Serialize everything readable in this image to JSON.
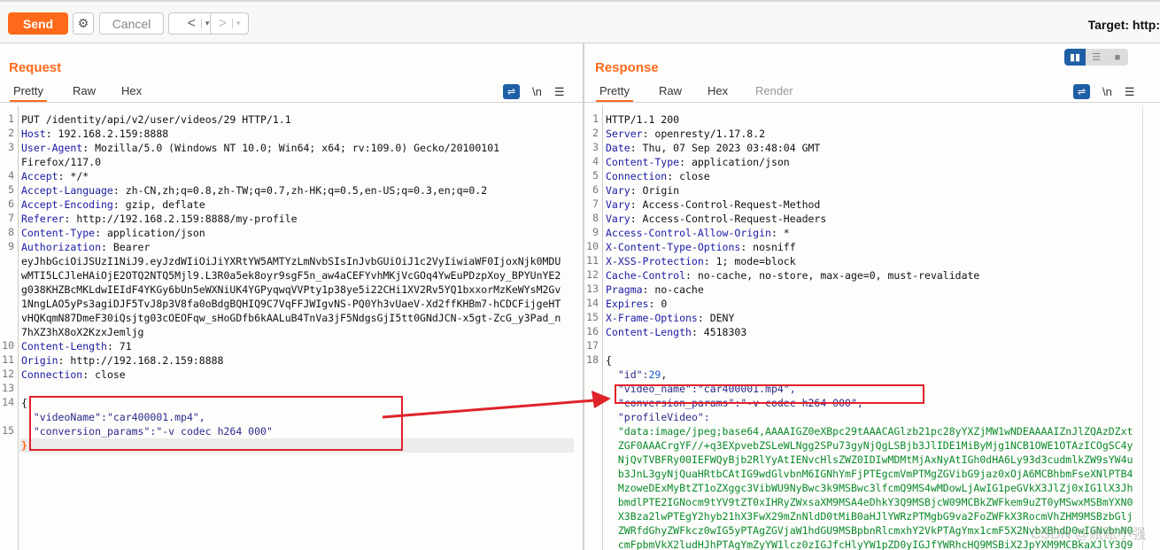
{
  "toolbar": {
    "send": "Send",
    "cancel": "Cancel",
    "back": "<",
    "forward": ">",
    "dropdown": "▾",
    "target": "Target: http:"
  },
  "request": {
    "title": "Request",
    "tabs": [
      "Pretty",
      "Raw",
      "Hex"
    ],
    "newline_label": "\\n",
    "lines": [
      {
        "n": "1",
        "segs": [
          [
            "v",
            "PUT /identity/api/v2/user/videos/29 HTTP/1.1"
          ]
        ]
      },
      {
        "n": "2",
        "segs": [
          [
            "k",
            "Host"
          ],
          [
            "v",
            ": 192.168.2.159:8888"
          ]
        ]
      },
      {
        "n": "3",
        "segs": [
          [
            "k",
            "User-Agent"
          ],
          [
            "v",
            ": Mozilla/5.0 (Windows NT 10.0; Win64; x64; rv:109.0) Gecko/20100101"
          ]
        ]
      },
      {
        "n": "",
        "segs": [
          [
            "v",
            "Firefox/117.0"
          ]
        ]
      },
      {
        "n": "4",
        "segs": [
          [
            "k",
            "Accept"
          ],
          [
            "v",
            ": */*"
          ]
        ]
      },
      {
        "n": "5",
        "segs": [
          [
            "k",
            "Accept-Language"
          ],
          [
            "v",
            ": zh-CN,zh;q=0.8,zh-TW;q=0.7,zh-HK;q=0.5,en-US;q=0.3,en;q=0.2"
          ]
        ]
      },
      {
        "n": "6",
        "segs": [
          [
            "k",
            "Accept-Encoding"
          ],
          [
            "v",
            ": gzip, deflate"
          ]
        ]
      },
      {
        "n": "7",
        "segs": [
          [
            "k",
            "Referer"
          ],
          [
            "v",
            ": http://192.168.2.159:8888/my-profile"
          ]
        ]
      },
      {
        "n": "8",
        "segs": [
          [
            "k",
            "Content-Type"
          ],
          [
            "v",
            ": application/json"
          ]
        ]
      },
      {
        "n": "9",
        "segs": [
          [
            "k",
            "Authorization"
          ],
          [
            "v",
            ": Bearer"
          ]
        ]
      },
      {
        "n": "",
        "segs": [
          [
            "v",
            "eyJhbGciOiJSUzI1NiJ9.eyJzdWIiOiJiYXRtYW5AMTYzLmNvbSIsInJvbGUiOiJ1c2VyIiwiaWF0IjoxNjk0MDU"
          ]
        ]
      },
      {
        "n": "",
        "segs": [
          [
            "v",
            "wMTI5LCJleHAiOjE2OTQ2NTQ5Mjl9.L3R0a5ek8oyr9sgF5n_aw4aCEFYvhMKjVcGOq4YwEuPDzpXoy_BPYUnYE2"
          ]
        ]
      },
      {
        "n": "",
        "segs": [
          [
            "v",
            "g038KHZBcMKLdwIEIdF4YKGy6bUn5eWXNiUK4YGPyqwqVVPty1p38ye5i22CHi1XV2Rv5YQ1bxxorMzKeWYsM2Gv"
          ]
        ]
      },
      {
        "n": "",
        "segs": [
          [
            "v",
            "1NngLAO5yPs3agiDJF5TvJ8p3V8fa0oBdgBQHIQ9C7VqFFJWIgvNS-PQ0Yh3vUaeV-Xd2ffKHBm7-hCDCFijgeHT"
          ]
        ]
      },
      {
        "n": "",
        "segs": [
          [
            "v",
            "vHQKqmN87DmeF30iQsjtg03cOEOFqw_sHoGDfb6kAALuB4TnVa3jF5NdgsGjI5tt0GNdJCN-x5gt-ZcG_y3Pad_n"
          ]
        ]
      },
      {
        "n": "",
        "segs": [
          [
            "v",
            "7hXZ3hX8oX2KzxJemljg"
          ]
        ]
      },
      {
        "n": "10",
        "segs": [
          [
            "k",
            "Content-Length"
          ],
          [
            "v",
            ": 71"
          ]
        ]
      },
      {
        "n": "11",
        "segs": [
          [
            "k",
            "Origin"
          ],
          [
            "v",
            ": http://192.168.2.159:8888"
          ]
        ]
      },
      {
        "n": "12",
        "segs": [
          [
            "k",
            "Connection"
          ],
          [
            "v",
            ": close"
          ]
        ]
      },
      {
        "n": "13",
        "segs": []
      },
      {
        "n": "14",
        "segs": [
          [
            "v",
            "{"
          ]
        ]
      },
      {
        "n": "",
        "segs": [
          [
            "v",
            "  "
          ],
          [
            "s",
            "\"videoName\":\"car400001.mp4\","
          ]
        ]
      },
      {
        "n": "15",
        "segs": [
          [
            "v",
            "  "
          ],
          [
            "s",
            "\"conversion_params\":\"-v codec h264 000\""
          ]
        ]
      },
      {
        "n": "",
        "segs": [
          [
            "o",
            "}"
          ]
        ]
      }
    ]
  },
  "response": {
    "title": "Response",
    "tabs": [
      "Pretty",
      "Raw",
      "Hex",
      "Render"
    ],
    "newline_label": "\\n",
    "lines": [
      {
        "n": "1",
        "segs": [
          [
            "v",
            "HTTP/1.1 200"
          ]
        ]
      },
      {
        "n": "2",
        "segs": [
          [
            "k",
            "Server"
          ],
          [
            "v",
            ": openresty/1.17.8.2"
          ]
        ]
      },
      {
        "n": "3",
        "segs": [
          [
            "k",
            "Date"
          ],
          [
            "v",
            ": Thu, 07 Sep 2023 03:48:04 GMT"
          ]
        ]
      },
      {
        "n": "4",
        "segs": [
          [
            "k",
            "Content-Type"
          ],
          [
            "v",
            ": application/json"
          ]
        ]
      },
      {
        "n": "5",
        "segs": [
          [
            "k",
            "Connection"
          ],
          [
            "v",
            ": close"
          ]
        ]
      },
      {
        "n": "6",
        "segs": [
          [
            "k",
            "Vary"
          ],
          [
            "v",
            ": Origin"
          ]
        ]
      },
      {
        "n": "7",
        "segs": [
          [
            "k",
            "Vary"
          ],
          [
            "v",
            ": Access-Control-Request-Method"
          ]
        ]
      },
      {
        "n": "8",
        "segs": [
          [
            "k",
            "Vary"
          ],
          [
            "v",
            ": Access-Control-Request-Headers"
          ]
        ]
      },
      {
        "n": "9",
        "segs": [
          [
            "k",
            "Access-Control-Allow-Origin"
          ],
          [
            "v",
            ": *"
          ]
        ]
      },
      {
        "n": "10",
        "segs": [
          [
            "k",
            "X-Content-Type-Options"
          ],
          [
            "v",
            ": nosniff"
          ]
        ]
      },
      {
        "n": "11",
        "segs": [
          [
            "k",
            "X-XSS-Protection"
          ],
          [
            "v",
            ": 1; mode=block"
          ]
        ]
      },
      {
        "n": "12",
        "segs": [
          [
            "k",
            "Cache-Control"
          ],
          [
            "v",
            ": no-cache, no-store, max-age=0, must-revalidate"
          ]
        ]
      },
      {
        "n": "13",
        "segs": [
          [
            "k",
            "Pragma"
          ],
          [
            "v",
            ": no-cache"
          ]
        ]
      },
      {
        "n": "14",
        "segs": [
          [
            "k",
            "Expires"
          ],
          [
            "v",
            ": 0"
          ]
        ]
      },
      {
        "n": "15",
        "segs": [
          [
            "k",
            "X-Frame-Options"
          ],
          [
            "v",
            ": DENY"
          ]
        ]
      },
      {
        "n": "16",
        "segs": [
          [
            "k",
            "Content-Length"
          ],
          [
            "v",
            ": 4518303"
          ]
        ]
      },
      {
        "n": "17",
        "segs": []
      },
      {
        "n": "18",
        "segs": [
          [
            "v",
            "{"
          ]
        ]
      },
      {
        "n": "",
        "segs": [
          [
            "v",
            "  "
          ],
          [
            "s",
            "\"id\":"
          ],
          [
            "n",
            "29"
          ],
          [
            "v",
            ","
          ]
        ]
      },
      {
        "n": "",
        "segs": [
          [
            "v",
            "  "
          ],
          [
            "s",
            "\"video_name\":\"car400001.mp4\","
          ]
        ]
      },
      {
        "n": "",
        "segs": [
          [
            "v",
            "  "
          ],
          [
            "s",
            "\"conversion_params\":\"-v codec h264 000\","
          ]
        ]
      },
      {
        "n": "",
        "segs": [
          [
            "v",
            "  "
          ],
          [
            "s",
            "\"profileVideo\":"
          ]
        ]
      },
      {
        "n": "",
        "segs": [
          [
            "v",
            "  "
          ],
          [
            "g",
            "\"data:image/jpeg;base64,AAAAIGZ0eXBpc29tAAACAGlzb21pc28yYXZjMW1wNDEAAAAIZnJlZQAzDZxt"
          ]
        ]
      },
      {
        "n": "",
        "segs": [
          [
            "v",
            "  "
          ],
          [
            "g",
            "ZGF0AAACrgYF//+q3EXpvebZSLeWLNgg2SPu73gyNjQgLSBjb3JlIDE1MiByMjg1NCB1OWE1OTAzICOgSC4y"
          ]
        ]
      },
      {
        "n": "",
        "segs": [
          [
            "v",
            "  "
          ],
          [
            "g",
            "NjQvTVBFRy00IEFWQyBjb2RlYyAtIENvcHlsZWZ0IDIwMDMtMjAxNyAtIGh0dHA6Ly93d3cudmlkZW9sYW4u"
          ]
        ]
      },
      {
        "n": "",
        "segs": [
          [
            "v",
            "  "
          ],
          [
            "g",
            "b3JnL3gyNjQuaHRtbCAtIG9wdGlvbnM6IGNhYmFjPTEgcmVmPTMgZGVibG9jaz0xOjA6MCBhbmFseXNlPTB4"
          ]
        ]
      },
      {
        "n": "",
        "segs": [
          [
            "v",
            "  "
          ],
          [
            "g",
            "MzoweDExMyBtZT1oZXggc3VibWU9NyBwc3k9MSBwc3lfcmQ9MS4wMDowLjAwIG1peGVkX3JlZj0xIG1lX3Jh"
          ]
        ]
      },
      {
        "n": "",
        "segs": [
          [
            "v",
            "  "
          ],
          [
            "g",
            "bmdlPTE2IGNocm9tYV9tZT0xIHRyZWxsaXM9MSA4eDhkY3Q9MSBjcW09MCBkZWFkem9uZT0yMSwxMSBmYXN0"
          ]
        ]
      },
      {
        "n": "",
        "segs": [
          [
            "v",
            "  "
          ],
          [
            "g",
            "X3Bza2lwPTEgY2hyb21hX3FwX29mZnNldD0tMiB0aHJlYWRzPTMgbG9va2FoZWFkX3RocmVhZHM9MSBzbGlj"
          ]
        ]
      },
      {
        "n": "",
        "segs": [
          [
            "v",
            "  "
          ],
          [
            "g",
            "ZWRfdGhyZWFkcz0wIG5yPTAgZGVjaW1hdGU9MSBpbnRlcmxhY2VkPTAgYmx1cmF5X2NvbXBhdD0wIGNvbnN0"
          ]
        ]
      },
      {
        "n": "",
        "segs": [
          [
            "v",
            "  "
          ],
          [
            "g",
            "cmFpbmVkX2ludHJhPTAgYmZyYW1lcz0zIGJfcHlyYW1pZD0yIGJfYWRhcHQ9MSBiX2JpYXM9MCBkaXJlY3Q9"
          ]
        ]
      }
    ]
  },
  "watermark": "CSDN @账账小强",
  "colors": {
    "accent": "#ff6a1a",
    "highlight_box": "#e0232b",
    "key": "#1a1aa6",
    "base64": "#0a8a2a"
  }
}
